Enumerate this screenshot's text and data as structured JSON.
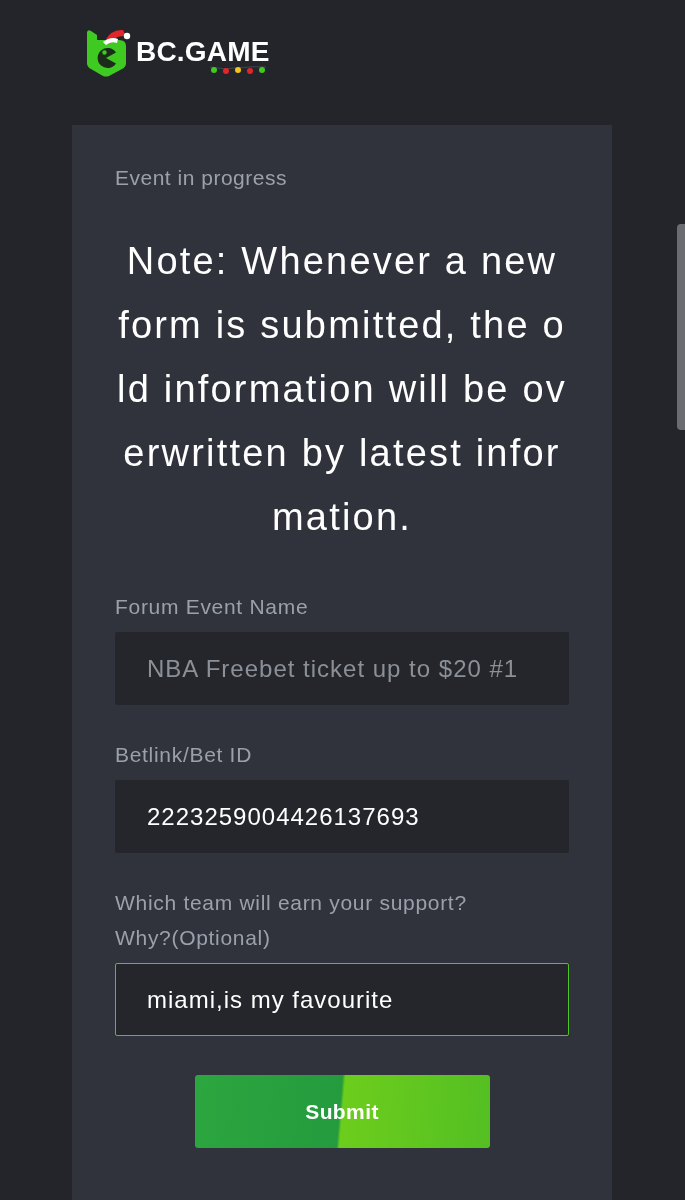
{
  "header": {
    "logo_text": "BC.GAME"
  },
  "form": {
    "status": "Event in progress",
    "note": "Note: Whenever a new form is submitted, the old information will be overwritten by latest information.",
    "fields": [
      {
        "label": "Forum Event Name",
        "value": "NBA Freebet ticket up to $20 #1",
        "disabled": true,
        "focused": false
      },
      {
        "label": "Betlink/Bet ID",
        "value": "2223259004426137693",
        "disabled": false,
        "focused": false
      },
      {
        "label": "Which team will earn your support? Why?(Optional)",
        "value": "miami,is my favourite",
        "disabled": false,
        "focused": true
      }
    ],
    "submit_button": "Submit"
  }
}
